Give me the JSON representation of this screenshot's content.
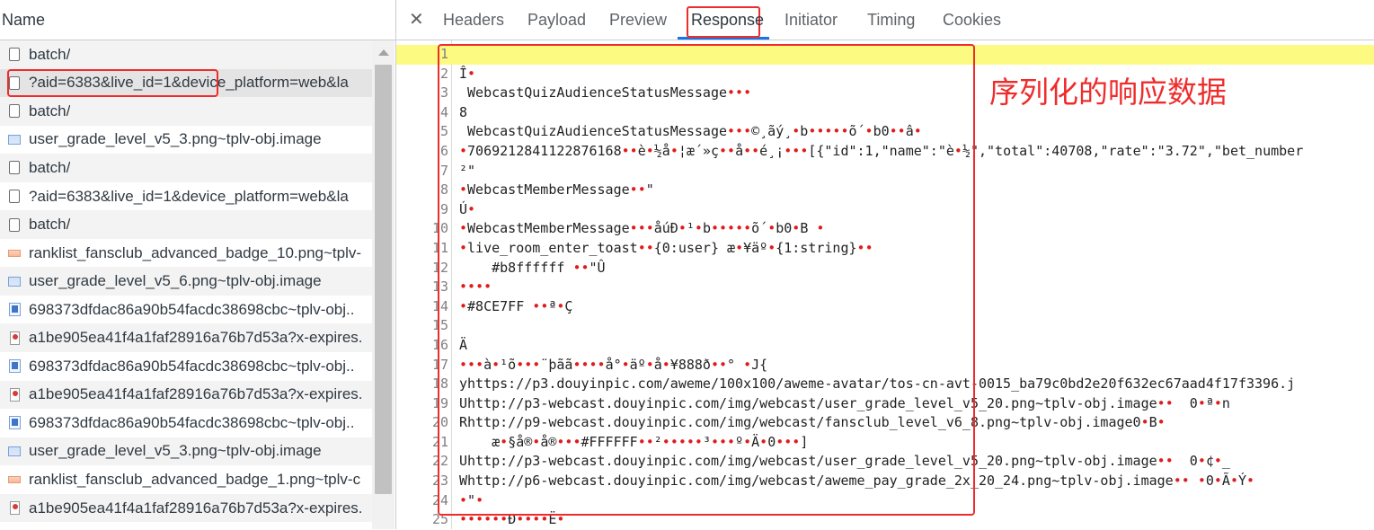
{
  "left_panel": {
    "header": "Name",
    "requests": [
      {
        "icon": "document-icon",
        "label": "batch/"
      },
      {
        "icon": "document-icon",
        "label": "?aid=6383&live_id=1&device_platform=web&la"
      },
      {
        "icon": "document-icon",
        "label": "batch/"
      },
      {
        "icon": "image-icon",
        "label": "user_grade_level_v5_3.png~tplv-obj.image"
      },
      {
        "icon": "document-icon",
        "label": "batch/"
      },
      {
        "icon": "document-icon",
        "label": "?aid=6383&live_id=1&device_platform=web&la"
      },
      {
        "icon": "document-icon",
        "label": "batch/"
      },
      {
        "icon": "orange-image-icon",
        "label": "ranklist_fansclub_advanced_badge_10.png~tplv-"
      },
      {
        "icon": "image-icon",
        "label": "user_grade_level_v5_6.png~tplv-obj.image"
      },
      {
        "icon": "image-file-icon",
        "label": "698373dfdac86a90b54facdc38698cbc~tplv-obj.."
      },
      {
        "icon": "red-image-icon",
        "label": "a1be905ea41f4a1faf28916a76b7d53a?x-expires."
      },
      {
        "icon": "image-file-icon",
        "label": "698373dfdac86a90b54facdc38698cbc~tplv-obj.."
      },
      {
        "icon": "red-image-icon",
        "label": "a1be905ea41f4a1faf28916a76b7d53a?x-expires."
      },
      {
        "icon": "image-file-icon",
        "label": "698373dfdac86a90b54facdc38698cbc~tplv-obj.."
      },
      {
        "icon": "image-icon",
        "label": "user_grade_level_v5_3.png~tplv-obj.image"
      },
      {
        "icon": "orange-image-icon",
        "label": "ranklist_fansclub_advanced_badge_1.png~tplv-c"
      },
      {
        "icon": "red-image-icon",
        "label": "a1be905ea41f4a1faf28916a76b7d53a?x-expires."
      }
    ]
  },
  "detail_panel": {
    "close_symbol": "✕",
    "tabs": [
      "Headers",
      "Payload",
      "Preview",
      "Response",
      "Initiator",
      "Timing",
      "Cookies"
    ],
    "active_tab": "Response",
    "annotation": "序列化的响应数据",
    "response_lines": [
      "",
      "Î•",
      " WebcastQuizAudienceStatusMessage•••",
      "8",
      " WebcastQuizAudienceStatusMessage•••©¸ãý¸•b•••••õ´•b0••â•",
      "•7069212841122876168••è•½å•¦æ´»ç••å••é¸¡•••[{\"id\":1,\"name\":\"è•½\",\"total\":40708,\"rate\":\"3.72\",\"bet_number",
      "²\"",
      "•WebcastMemberMessage••\"",
      "Ú•",
      "•WebcastMemberMessage•••åúÐ•¹•b•••••õ´•b0•B •",
      "•live_room_enter_toast••{0:user} æ•¥äº•{1:string}••",
      "    #b8ffffff ••\"Û",
      "••••",
      "•#8CE7FF ••ª•Ç",
      "",
      "Ä",
      "•••à•¹õ•••¨þãã••••å°•äº•å•¥888ð••° •J{",
      "yhttps://p3.douyinpic.com/aweme/100x100/aweme-avatar/tos-cn-avt-0015_ba79c0bd2e20f632ec67aad4f17f3396.j",
      "Uhttp://p3-webcast.douyinpic.com/img/webcast/user_grade_level_v5_20.png~tplv-obj.image••  0•ª•n",
      "Rhttp://p9-webcast.douyinpic.com/img/webcast/fansclub_level_v6_8.png~tplv-obj.image0•B•",
      "    æ•§å®•å®•••#FFFFFF••²•••••³•••º•Ä•0•••]",
      "Uhttp://p3-webcast.douyinpic.com/img/webcast/user_grade_level_v5_20.png~tplv-obj.image••  0•¢•_",
      "Whttp://p6-webcast.douyinpic.com/img/webcast/aweme_pay_grade_2x_20_24.png~tplv-obj.image•• •0•Ã•Ý•",
      "•\"•",
      "••••••Ð••••Ë•"
    ]
  }
}
